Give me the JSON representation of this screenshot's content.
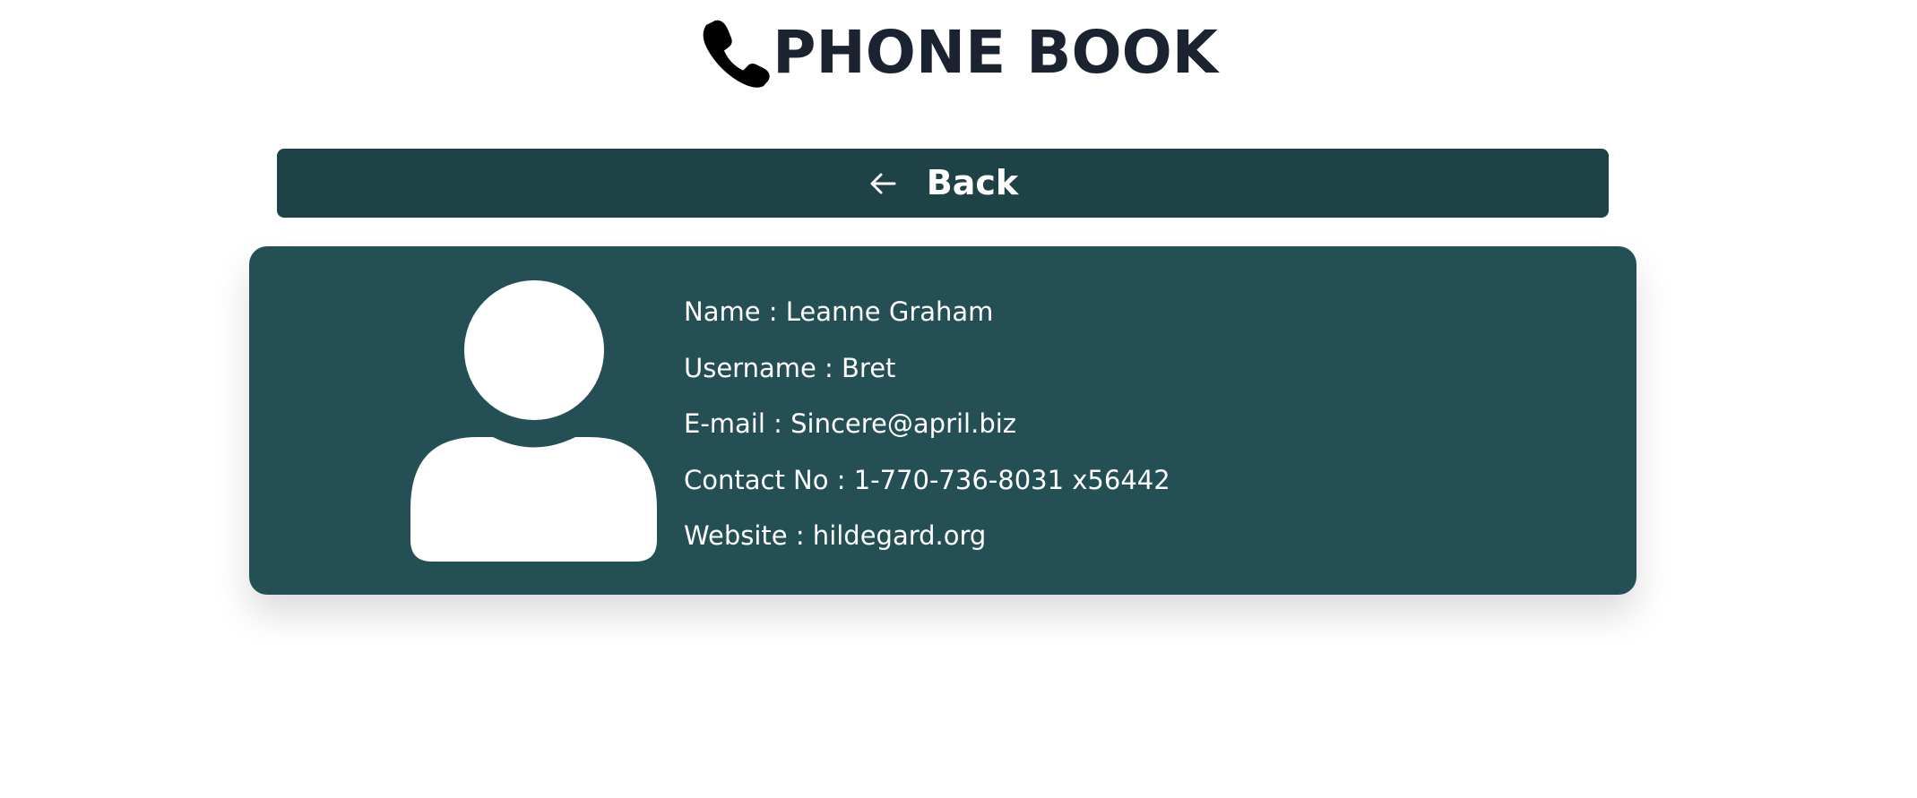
{
  "header": {
    "title": "PHONE BOOK",
    "icon": "phone-icon"
  },
  "back_button": {
    "label": "Back",
    "icon": "arrow-left-icon"
  },
  "contact": {
    "avatar_icon": "user-icon",
    "fields": [
      {
        "label": "Name",
        "value": "Leanne Graham",
        "text": "Name : Leanne Graham"
      },
      {
        "label": "Username",
        "value": "Bret",
        "text": "Username : Bret"
      },
      {
        "label": "E-mail",
        "value": "Sincere@april.biz",
        "text": "E-mail : Sincere@april.biz"
      },
      {
        "label": "Contact No",
        "value": "1-770-736-8031 x56442",
        "text": "Contact No : 1-770-736-8031 x56442"
      },
      {
        "label": "Website",
        "value": "hildegard.org",
        "text": "Website : hildegard.org"
      }
    ]
  },
  "colors": {
    "title": "#1c2330",
    "back_button_bg": "#1f4247",
    "card_bg": "#245055",
    "text_on_dark": "#ffffff"
  }
}
